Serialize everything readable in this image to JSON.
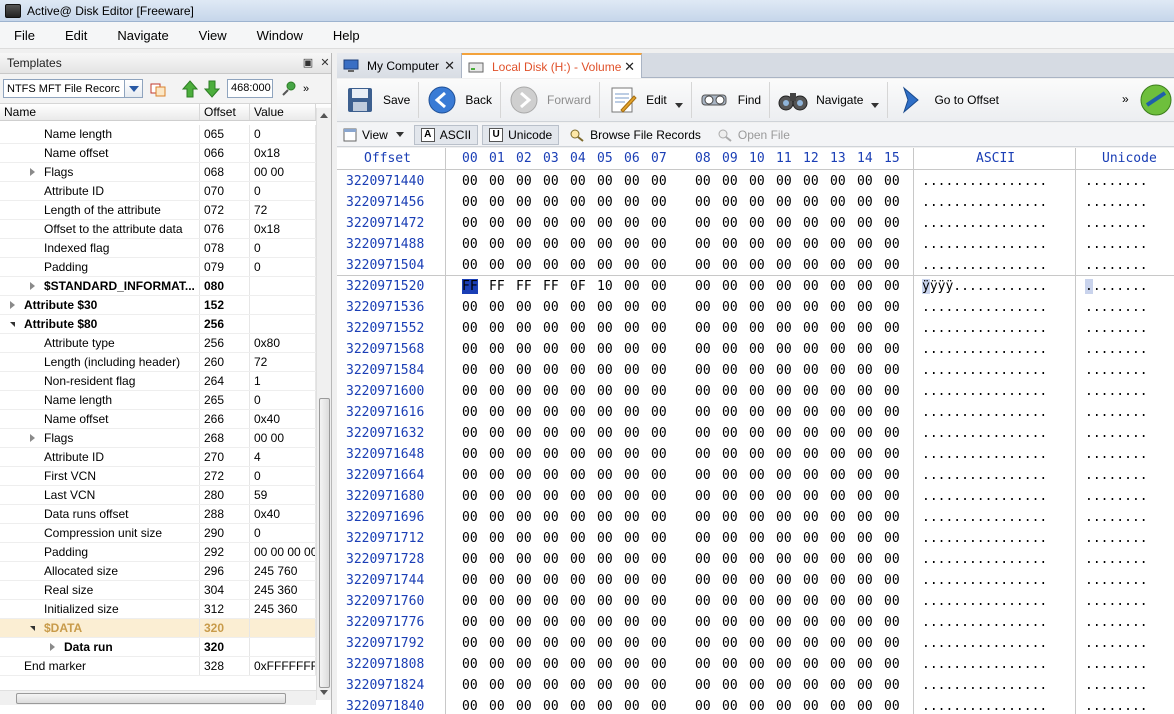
{
  "window": {
    "title": "Active@ Disk Editor [Freeware]"
  },
  "menu": [
    "File",
    "Edit",
    "Navigate",
    "View",
    "Window",
    "Help"
  ],
  "templates_panel": {
    "header": "Templates",
    "template_select": "NTFS MFT File Recorc",
    "offset_value": "468:000",
    "columns": [
      "Name",
      "Offset",
      "Value"
    ],
    "rows": [
      {
        "name": "Name length",
        "offset": "065",
        "value": "0",
        "indent": 2,
        "expander": "",
        "bold": false
      },
      {
        "name": "Name offset",
        "offset": "066",
        "value": "0x18",
        "indent": 2,
        "expander": "",
        "bold": false
      },
      {
        "name": "Flags",
        "offset": "068",
        "value": "00 00",
        "indent": 2,
        "expander": "closed",
        "bold": false
      },
      {
        "name": "Attribute ID",
        "offset": "070",
        "value": "0",
        "indent": 2,
        "expander": "",
        "bold": false
      },
      {
        "name": "Length of the attribute",
        "offset": "072",
        "value": "72",
        "indent": 2,
        "expander": "",
        "bold": false
      },
      {
        "name": "Offset to the attribute data",
        "offset": "076",
        "value": "0x18",
        "indent": 2,
        "expander": "",
        "bold": false
      },
      {
        "name": "Indexed flag",
        "offset": "078",
        "value": "0",
        "indent": 2,
        "expander": "",
        "bold": false
      },
      {
        "name": "Padding",
        "offset": "079",
        "value": "0",
        "indent": 2,
        "expander": "",
        "bold": false
      },
      {
        "name": "$STANDARD_INFORMAT...",
        "offset": "080",
        "value": "",
        "indent": 2,
        "expander": "closed",
        "bold": true
      },
      {
        "name": "Attribute $30",
        "offset": "152",
        "value": "",
        "indent": 1,
        "expander": "closed",
        "bold": true
      },
      {
        "name": "Attribute $80",
        "offset": "256",
        "value": "",
        "indent": 1,
        "expander": "open",
        "bold": true
      },
      {
        "name": "Attribute type",
        "offset": "256",
        "value": "0x80",
        "indent": 2,
        "expander": "",
        "bold": false
      },
      {
        "name": "Length (including header)",
        "offset": "260",
        "value": "72",
        "indent": 2,
        "expander": "",
        "bold": false
      },
      {
        "name": "Non-resident flag",
        "offset": "264",
        "value": "1",
        "indent": 2,
        "expander": "",
        "bold": false
      },
      {
        "name": "Name length",
        "offset": "265",
        "value": "0",
        "indent": 2,
        "expander": "",
        "bold": false
      },
      {
        "name": "Name offset",
        "offset": "266",
        "value": "0x40",
        "indent": 2,
        "expander": "",
        "bold": false
      },
      {
        "name": "Flags",
        "offset": "268",
        "value": "00 00",
        "indent": 2,
        "expander": "closed",
        "bold": false
      },
      {
        "name": "Attribute ID",
        "offset": "270",
        "value": "4",
        "indent": 2,
        "expander": "",
        "bold": false
      },
      {
        "name": "First VCN",
        "offset": "272",
        "value": "0",
        "indent": 2,
        "expander": "",
        "bold": false
      },
      {
        "name": "Last VCN",
        "offset": "280",
        "value": "59",
        "indent": 2,
        "expander": "",
        "bold": false
      },
      {
        "name": "Data runs offset",
        "offset": "288",
        "value": "0x40",
        "indent": 2,
        "expander": "",
        "bold": false
      },
      {
        "name": "Compression unit size",
        "offset": "290",
        "value": "0",
        "indent": 2,
        "expander": "",
        "bold": false
      },
      {
        "name": "Padding",
        "offset": "292",
        "value": "00 00 00 00",
        "indent": 2,
        "expander": "",
        "bold": false
      },
      {
        "name": "Allocated size",
        "offset": "296",
        "value": "245 760",
        "indent": 2,
        "expander": "",
        "bold": false
      },
      {
        "name": "Real size",
        "offset": "304",
        "value": "245 360",
        "indent": 2,
        "expander": "",
        "bold": false
      },
      {
        "name": "Initialized size",
        "offset": "312",
        "value": "245 360",
        "indent": 2,
        "expander": "",
        "bold": false
      },
      {
        "name": "$DATA",
        "offset": "320",
        "value": "",
        "indent": 2,
        "expander": "open",
        "bold": true,
        "selected": true
      },
      {
        "name": "Data run",
        "offset": "320",
        "value": "",
        "indent": 3,
        "expander": "closed",
        "bold": true
      },
      {
        "name": "End marker",
        "offset": "328",
        "value": "0xFFFFFFFF",
        "indent": 1,
        "expander": "",
        "bold": false
      }
    ]
  },
  "tabs": [
    {
      "label": "My Computer",
      "active": false
    },
    {
      "label": "Local Disk (H:) - Volume",
      "active": true
    }
  ],
  "toolbar": {
    "save": "Save",
    "back": "Back",
    "forward": "Forward",
    "edit": "Edit",
    "find": "Find",
    "navigate": "Navigate",
    "goto": "Go to Offset",
    "more": "»"
  },
  "toolbar2": {
    "view": "View",
    "ascii": "ASCII",
    "unicode": "Unicode",
    "browse": "Browse File Records",
    "open_file": "Open File"
  },
  "hex": {
    "header_offset": "Offset",
    "header_bytes": [
      "00",
      "01",
      "02",
      "03",
      "04",
      "05",
      "06",
      "07",
      "08",
      "09",
      "10",
      "11",
      "12",
      "13",
      "14",
      "15"
    ],
    "header_ascii": "ASCII",
    "header_unicode": "Unicode",
    "rows": [
      {
        "offset": "3220971440",
        "bytes": [
          "00",
          "00",
          "00",
          "00",
          "00",
          "00",
          "00",
          "00",
          "00",
          "00",
          "00",
          "00",
          "00",
          "00",
          "00",
          "00"
        ],
        "ascii": "................",
        "unicode": "........"
      },
      {
        "offset": "3220971456",
        "bytes": [
          "00",
          "00",
          "00",
          "00",
          "00",
          "00",
          "00",
          "00",
          "00",
          "00",
          "00",
          "00",
          "00",
          "00",
          "00",
          "00"
        ],
        "ascii": "................",
        "unicode": "........"
      },
      {
        "offset": "3220971472",
        "bytes": [
          "00",
          "00",
          "00",
          "00",
          "00",
          "00",
          "00",
          "00",
          "00",
          "00",
          "00",
          "00",
          "00",
          "00",
          "00",
          "00"
        ],
        "ascii": "................",
        "unicode": "........"
      },
      {
        "offset": "3220971488",
        "bytes": [
          "00",
          "00",
          "00",
          "00",
          "00",
          "00",
          "00",
          "00",
          "00",
          "00",
          "00",
          "00",
          "00",
          "00",
          "00",
          "00"
        ],
        "ascii": "................",
        "unicode": "........"
      },
      {
        "offset": "3220971504",
        "bytes": [
          "00",
          "00",
          "00",
          "00",
          "00",
          "00",
          "00",
          "00",
          "00",
          "00",
          "00",
          "00",
          "00",
          "00",
          "00",
          "00"
        ],
        "ascii": "................",
        "unicode": "........"
      },
      {
        "offset": "3220971520",
        "bytes": [
          "FF",
          "FF",
          "FF",
          "FF",
          "0F",
          "10",
          "00",
          "00",
          "00",
          "00",
          "00",
          "00",
          "00",
          "00",
          "00",
          "00"
        ],
        "ascii": "ÿÿÿÿ............",
        "unicode": "........"
      },
      {
        "offset": "3220971536",
        "bytes": [
          "00",
          "00",
          "00",
          "00",
          "00",
          "00",
          "00",
          "00",
          "00",
          "00",
          "00",
          "00",
          "00",
          "00",
          "00",
          "00"
        ],
        "ascii": "................",
        "unicode": "........"
      },
      {
        "offset": "3220971552",
        "bytes": [
          "00",
          "00",
          "00",
          "00",
          "00",
          "00",
          "00",
          "00",
          "00",
          "00",
          "00",
          "00",
          "00",
          "00",
          "00",
          "00"
        ],
        "ascii": "................",
        "unicode": "........"
      },
      {
        "offset": "3220971568",
        "bytes": [
          "00",
          "00",
          "00",
          "00",
          "00",
          "00",
          "00",
          "00",
          "00",
          "00",
          "00",
          "00",
          "00",
          "00",
          "00",
          "00"
        ],
        "ascii": "................",
        "unicode": "........"
      },
      {
        "offset": "3220971584",
        "bytes": [
          "00",
          "00",
          "00",
          "00",
          "00",
          "00",
          "00",
          "00",
          "00",
          "00",
          "00",
          "00",
          "00",
          "00",
          "00",
          "00"
        ],
        "ascii": "................",
        "unicode": "........"
      },
      {
        "offset": "3220971600",
        "bytes": [
          "00",
          "00",
          "00",
          "00",
          "00",
          "00",
          "00",
          "00",
          "00",
          "00",
          "00",
          "00",
          "00",
          "00",
          "00",
          "00"
        ],
        "ascii": "................",
        "unicode": "........"
      },
      {
        "offset": "3220971616",
        "bytes": [
          "00",
          "00",
          "00",
          "00",
          "00",
          "00",
          "00",
          "00",
          "00",
          "00",
          "00",
          "00",
          "00",
          "00",
          "00",
          "00"
        ],
        "ascii": "................",
        "unicode": "........"
      },
      {
        "offset": "3220971632",
        "bytes": [
          "00",
          "00",
          "00",
          "00",
          "00",
          "00",
          "00",
          "00",
          "00",
          "00",
          "00",
          "00",
          "00",
          "00",
          "00",
          "00"
        ],
        "ascii": "................",
        "unicode": "........"
      },
      {
        "offset": "3220971648",
        "bytes": [
          "00",
          "00",
          "00",
          "00",
          "00",
          "00",
          "00",
          "00",
          "00",
          "00",
          "00",
          "00",
          "00",
          "00",
          "00",
          "00"
        ],
        "ascii": "................",
        "unicode": "........"
      },
      {
        "offset": "3220971664",
        "bytes": [
          "00",
          "00",
          "00",
          "00",
          "00",
          "00",
          "00",
          "00",
          "00",
          "00",
          "00",
          "00",
          "00",
          "00",
          "00",
          "00"
        ],
        "ascii": "................",
        "unicode": "........"
      },
      {
        "offset": "3220971680",
        "bytes": [
          "00",
          "00",
          "00",
          "00",
          "00",
          "00",
          "00",
          "00",
          "00",
          "00",
          "00",
          "00",
          "00",
          "00",
          "00",
          "00"
        ],
        "ascii": "................",
        "unicode": "........"
      },
      {
        "offset": "3220971696",
        "bytes": [
          "00",
          "00",
          "00",
          "00",
          "00",
          "00",
          "00",
          "00",
          "00",
          "00",
          "00",
          "00",
          "00",
          "00",
          "00",
          "00"
        ],
        "ascii": "................",
        "unicode": "........"
      },
      {
        "offset": "3220971712",
        "bytes": [
          "00",
          "00",
          "00",
          "00",
          "00",
          "00",
          "00",
          "00",
          "00",
          "00",
          "00",
          "00",
          "00",
          "00",
          "00",
          "00"
        ],
        "ascii": "................",
        "unicode": "........"
      },
      {
        "offset": "3220971728",
        "bytes": [
          "00",
          "00",
          "00",
          "00",
          "00",
          "00",
          "00",
          "00",
          "00",
          "00",
          "00",
          "00",
          "00",
          "00",
          "00",
          "00"
        ],
        "ascii": "................",
        "unicode": "........"
      },
      {
        "offset": "3220971744",
        "bytes": [
          "00",
          "00",
          "00",
          "00",
          "00",
          "00",
          "00",
          "00",
          "00",
          "00",
          "00",
          "00",
          "00",
          "00",
          "00",
          "00"
        ],
        "ascii": "................",
        "unicode": "........"
      },
      {
        "offset": "3220971760",
        "bytes": [
          "00",
          "00",
          "00",
          "00",
          "00",
          "00",
          "00",
          "00",
          "00",
          "00",
          "00",
          "00",
          "00",
          "00",
          "00",
          "00"
        ],
        "ascii": "................",
        "unicode": "........"
      },
      {
        "offset": "3220971776",
        "bytes": [
          "00",
          "00",
          "00",
          "00",
          "00",
          "00",
          "00",
          "00",
          "00",
          "00",
          "00",
          "00",
          "00",
          "00",
          "00",
          "00"
        ],
        "ascii": "................",
        "unicode": "........"
      },
      {
        "offset": "3220971792",
        "bytes": [
          "00",
          "00",
          "00",
          "00",
          "00",
          "00",
          "00",
          "00",
          "00",
          "00",
          "00",
          "00",
          "00",
          "00",
          "00",
          "00"
        ],
        "ascii": "................",
        "unicode": "........"
      },
      {
        "offset": "3220971808",
        "bytes": [
          "00",
          "00",
          "00",
          "00",
          "00",
          "00",
          "00",
          "00",
          "00",
          "00",
          "00",
          "00",
          "00",
          "00",
          "00",
          "00"
        ],
        "ascii": "................",
        "unicode": "........"
      },
      {
        "offset": "3220971824",
        "bytes": [
          "00",
          "00",
          "00",
          "00",
          "00",
          "00",
          "00",
          "00",
          "00",
          "00",
          "00",
          "00",
          "00",
          "00",
          "00",
          "00"
        ],
        "ascii": "................",
        "unicode": "........"
      },
      {
        "offset": "3220971840",
        "bytes": [
          "00",
          "00",
          "00",
          "00",
          "00",
          "00",
          "00",
          "00",
          "00",
          "00",
          "00",
          "00",
          "00",
          "00",
          "00",
          "00"
        ],
        "ascii": "................",
        "unicode": "........"
      }
    ]
  }
}
